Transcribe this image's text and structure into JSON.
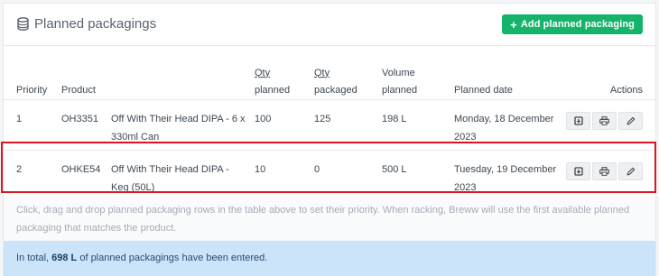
{
  "header": {
    "title": "Planned packagings",
    "title_icon": "database-icon",
    "add_button_label": "Add planned packaging",
    "add_button_icon": "plus-icon",
    "accent_color": "#16b36b"
  },
  "table": {
    "columns": {
      "priority": "Priority",
      "product": "Product",
      "qty_planned_1": "Qty",
      "qty_planned_2": "planned",
      "qty_packaged_1": "Qty",
      "qty_packaged_2": "packaged",
      "volume_1": "Volume",
      "volume_2": "planned",
      "planned_date": "Planned date",
      "actions": "Actions"
    },
    "rows": [
      {
        "priority": "1",
        "code": "OH3351",
        "name": "Off With Their Head DIPA - 6 x 330ml Can",
        "qty_planned": "100",
        "qty_packaged": "125",
        "volume": "198 L",
        "date": "Monday, 18 December 2023"
      },
      {
        "priority": "2",
        "code": "OHKE54",
        "name": "Off With Their Head DIPA - Keg (50L)",
        "qty_planned": "10",
        "qty_packaged": "0",
        "volume": "500 L",
        "date": "Tuesday, 19 December 2023"
      }
    ],
    "row_action_icons": [
      "archive-icon",
      "print-icon",
      "edit-icon"
    ]
  },
  "hint": "Click, drag and drop planned packaging rows in the table above to set their priority. When racking, Breww will use the first available planned packaging that matches the product.",
  "summary": {
    "prefix": "In total, ",
    "total": "698 L",
    "suffix": " of planned packagings have been entered."
  },
  "highlight_color": "#e0141e"
}
